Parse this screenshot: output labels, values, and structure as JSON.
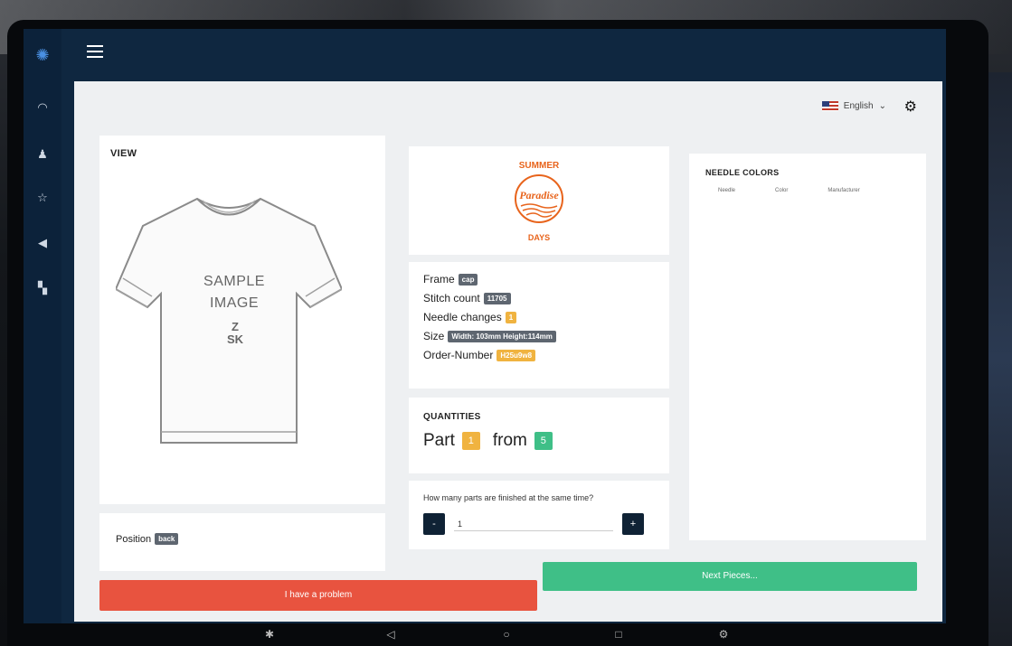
{
  "sidebar": {
    "icons": [
      "gear-logo-icon",
      "dashboard-icon",
      "users-icon",
      "star-icon",
      "send-icon",
      "stats-icon"
    ]
  },
  "header": {
    "language": "English",
    "language_chevron": "⌄"
  },
  "view": {
    "title": "VIEW",
    "sample_line1": "SAMPLE",
    "sample_line2": "IMAGE",
    "brand_z": "Z",
    "brand_sk": "SK"
  },
  "position": {
    "label": "Position",
    "value": "back"
  },
  "logo": {
    "top_text": "SUMMER",
    "middle_text": "Paradise",
    "bottom_text": "DAYS"
  },
  "info": {
    "frame_label": "Frame",
    "frame_value": "cap",
    "stitch_label": "Stitch count",
    "stitch_value": "11705",
    "needle_label": "Needle changes",
    "needle_value": "1",
    "size_label": "Size",
    "size_value": "Width: 103mm Height:114mm",
    "order_label": "Order-Number",
    "order_value": "H25u9w8"
  },
  "quantities": {
    "title": "QUANTITIES",
    "part_label": "Part",
    "part_value": "1",
    "from_label": "from",
    "from_value": "5"
  },
  "finish": {
    "question": "How many parts are finished at the same time?",
    "minus": "-",
    "value": "1",
    "plus": "+"
  },
  "needle_colors": {
    "title": "NEEDLE COLORS",
    "headers": [
      "Needle",
      "Color",
      "Manufacturer"
    ]
  },
  "actions": {
    "problem": "I have a problem",
    "next": "Next Pieces..."
  },
  "colors": {
    "accent": "#0f2740",
    "danger": "#e8533f",
    "success": "#3fbf87",
    "warning": "#f0b340",
    "logo_orange": "#e8641c"
  }
}
